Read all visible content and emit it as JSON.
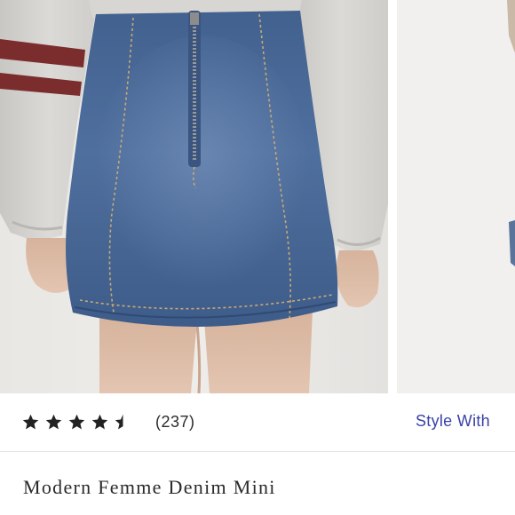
{
  "product": {
    "rating": {
      "stars": 4.5,
      "max_stars": 5,
      "review_count_label": "(237)"
    },
    "style_with_label": "Style With",
    "title": "Modern Femme Denim Mini"
  },
  "colors": {
    "accent_link": "#3a41a8",
    "text": "#2b2b2b",
    "star": "#222222"
  },
  "icons": [
    "star-icon",
    "half-star-icon"
  ]
}
